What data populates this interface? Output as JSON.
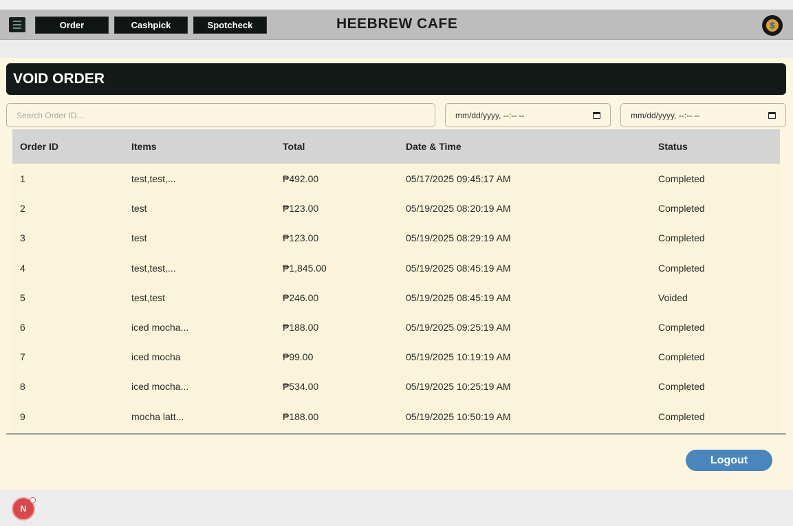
{
  "nav": {
    "buttons": [
      "Order",
      "Cashpick",
      "Spotcheck"
    ],
    "brand": "HEEBREW CAFE",
    "coin_symbol": "$"
  },
  "page": {
    "title": "VOID ORDER"
  },
  "filters": {
    "search_placeholder": "Search Order ID...",
    "date_from": "mm/dd/yyyy, --:-- --",
    "date_to": "mm/dd/yyyy, --:-- --"
  },
  "table": {
    "headers": [
      "Order ID",
      "Items",
      "Total",
      "Date & Time",
      "Status"
    ],
    "rows": [
      [
        "1",
        "test,test,...",
        "₱492.00",
        "05/17/2025 09:45:17 AM",
        "Completed"
      ],
      [
        "2",
        "test",
        "₱123.00",
        "05/19/2025 08:20:19 AM",
        "Completed"
      ],
      [
        "3",
        "test",
        "₱123.00",
        "05/19/2025 08:29:19 AM",
        "Completed"
      ],
      [
        "4",
        "test,test,...",
        "₱1,845.00",
        "05/19/2025 08:45:19 AM",
        "Completed"
      ],
      [
        "5",
        "test,test",
        "₱246.00",
        "05/19/2025 08:45:19 AM",
        "Voided"
      ],
      [
        "6",
        "iced mocha...",
        "₱188.00",
        "05/19/2025 09:25:19 AM",
        "Completed"
      ],
      [
        "7",
        "iced mocha",
        "₱99.00",
        "05/19/2025 10:19:19 AM",
        "Completed"
      ],
      [
        "8",
        "iced mocha...",
        "₱534.00",
        "05/19/2025 10:25:19 AM",
        "Completed"
      ],
      [
        "9",
        "mocha latt...",
        "₱188.00",
        "05/19/2025 10:50:19 AM",
        "Completed"
      ]
    ]
  },
  "actions": {
    "logout_label": "Logout"
  },
  "dev_badge": {
    "letter": "N"
  },
  "colors": {
    "nav_bg": "#bdbdbd",
    "dark": "#141a18",
    "content_bg": "#fcf6e1",
    "logout": "#4a86bb",
    "badge": "#d8484a"
  }
}
